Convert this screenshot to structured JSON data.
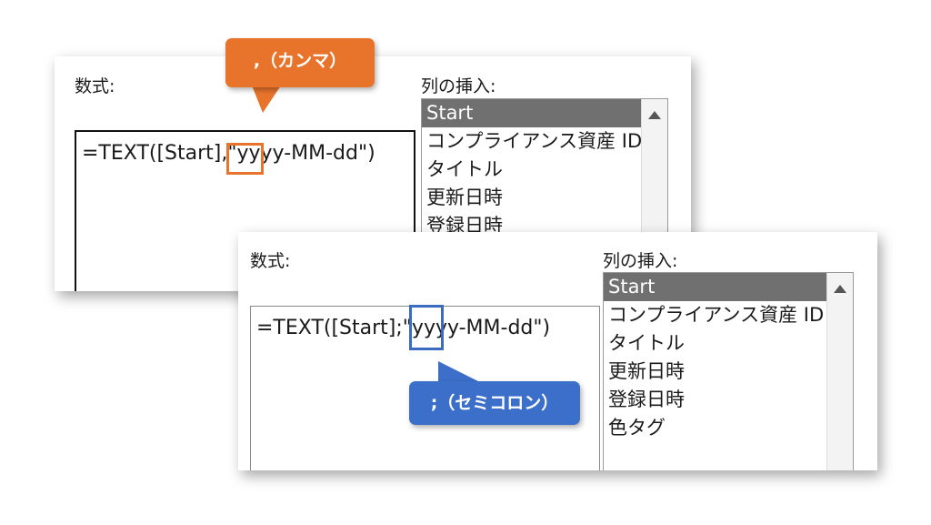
{
  "top_dialog": {
    "formula_label": "数式:",
    "insert_column_label": "列の挿入:",
    "formula_text": "=TEXT([Start],\"yyyy-MM-dd\")",
    "columns": [
      "Start",
      "コンプライアンス資産 ID",
      "タイトル",
      "更新日時",
      "登録日時"
    ],
    "selected_index": 0
  },
  "bottom_dialog": {
    "formula_label": "数式:",
    "insert_column_label": "列の挿入:",
    "formula_text": "=TEXT([Start];\"yyyy-MM-dd\")",
    "columns": [
      "Start",
      "コンプライアンス資産 ID",
      "タイトル",
      "更新日時",
      "登録日時",
      "色タグ"
    ],
    "selected_index": 0
  },
  "annotations": {
    "comma_label": ",（カンマ）",
    "semicolon_label": ";（セミコロン）"
  },
  "colors": {
    "comma_accent": "#e8742b",
    "semicolon_accent": "#3c6fc9",
    "selection": "#707070"
  }
}
